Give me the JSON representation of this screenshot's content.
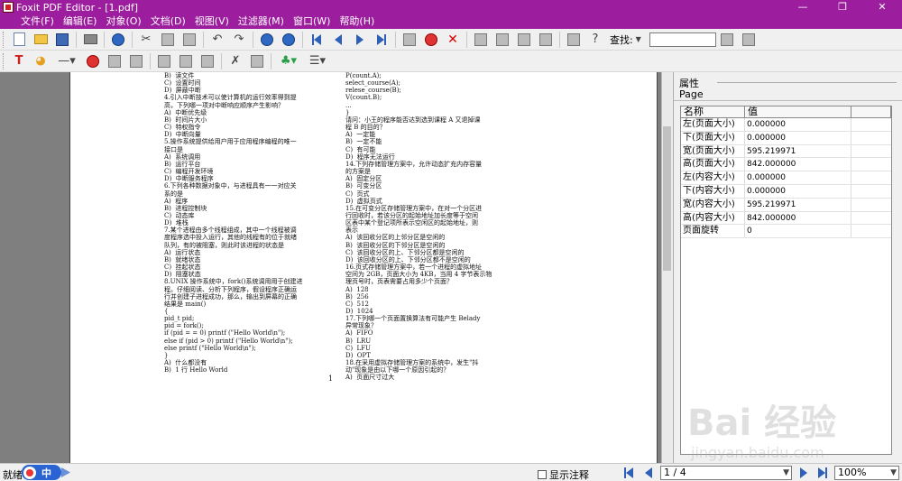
{
  "window": {
    "title": "Foxit PDF Editor - [1.pdf]",
    "controls": {
      "minimize": "—",
      "maximize": "❐",
      "close": "✕"
    }
  },
  "menu": [
    "文件(F)",
    "编辑(E)",
    "对象(O)",
    "文档(D)",
    "视图(V)",
    "过滤器(M)",
    "窗口(W)",
    "帮助(H)"
  ],
  "toolbar": {
    "search_label": "查找:",
    "search_value": ""
  },
  "document": {
    "page_number": "1",
    "column1": [
      "B)  读文件",
      "C)  设置时间",
      "D)  屏蔽中断",
      "4.引入中断技术可以使计算机的运行效率得到提",
      "高，下列哪一项对中断响应顺序产生影响？",
      "A)  中断优先级",
      "B)  时间片大小",
      "C)  特权指令",
      "D)  中断向量",
      "5.操作系统提供给用户用于应用程序编程的唯一",
      "接口是",
      "A)  系统调用",
      "B)  运行平台",
      "C)  编程开发环境",
      "D)  中断服务程序",
      "6.下列各种数据对象中，与进程具有一一对应关",
      "系的是",
      "A)  程序",
      "B)  进程控制块",
      "C)  动态库",
      "D)  堆栈",
      "7.某个进程由多个线程组成，其中一个线程被调",
      "度程序选中投入运行，其他的线程有的位于就绪",
      "队列，有的被阻塞，则此时该进程的状态是",
      "A)  运行状态",
      "B)  就绪状态",
      "C)  挂起状态",
      "D)  阻塞状态",
      "8.UNIX 操作系统中，fork()系统调用用于创建进",
      "程。仔细阅读、分析下列程序，假设程序正确运",
      "行并创建子进程成功，那么，输出到屏幕的正确",
      "结果是 main()",
      "{",
      "pid_t pid;",
      "pid = fork();",
      "if (pid = = 0) printf (\"Hello World\\n\");",
      "else if (pid > 0) printf (\"Hello World\\n\");",
      "else printf (\"Hello World\\n\");",
      "}",
      "A)  什么都没有",
      "B)  1 行 Hello World"
    ],
    "column2": [
      "P(count.A);",
      "select_course(A);",
      "relese_course(B);",
      "V(count.B);",
      "...",
      "}",
      "请问：小王的程序能否达到选到课程 A 又退掉课",
      "程 B 的目的？",
      "A)  一定能",
      "B)  一定不能",
      "C)  有可能",
      "D)  程序无法运行",
      "14.下列存储管理方案中，允许动态扩充内存容量",
      "的方案是",
      "A)  固定分区",
      "B)  可变分区",
      "C)  页式",
      "D)  虚拟页式",
      "15.在可变分区存储管理方案中，在对一个分区进",
      "行回收时，若该分区的起始地址加长度等于空闲",
      "区表中某个登记项所表示空闲区的起始地址，则",
      "表示",
      "A)  该回收分区的上邻分区是空闲的",
      "B)  该回收分区的下邻分区是空闲的",
      "C)  该回收分区的上、下邻分区都是空闲的",
      "D)  该回收分区的上、下邻分区都不是空闲的",
      "16.页式存储管理方案中，若一个进程的虚拟地址",
      "空间为 2GB，页面大小为 4KB，当用 4 字节表示物",
      "理页号时，页表需要占用多少个页面？",
      "A)  128",
      "B)  256",
      "C)  512",
      "D)  1024",
      "17.下列哪一个页面置换算法有可能产生 Belady",
      "异常现象？",
      "A)  FIFO",
      "B)  LRU",
      "C)  LFU",
      "D)  OPT",
      "18.在采用虚拟存储管理方案的系统中，发生\"抖",
      "动\"现象是由以下哪一个原因引起的？",
      "A)  页面尺寸过大"
    ]
  },
  "panel": {
    "title": "属性",
    "tab": "Page",
    "headers": [
      "名称",
      "值"
    ],
    "rows": [
      {
        "name": "左(页面大小)",
        "value": "0.000000"
      },
      {
        "name": "下(页面大小)",
        "value": "0.000000"
      },
      {
        "name": "宽(页面大小)",
        "value": "595.219971"
      },
      {
        "name": "高(页面大小)",
        "value": "842.000000"
      },
      {
        "name": "左(内容大小)",
        "value": "0.000000"
      },
      {
        "name": "下(内容大小)",
        "value": "0.000000"
      },
      {
        "name": "宽(内容大小)",
        "value": "595.219971"
      },
      {
        "name": "高(内容大小)",
        "value": "842.000000"
      },
      {
        "name": "页面旋转",
        "value": "0"
      }
    ]
  },
  "statusbar": {
    "status": "就绪",
    "ime_label": "中",
    "show_annotations": "显示注释",
    "page_indicator": "1 / 4",
    "zoom": "100%"
  },
  "watermark": {
    "main": "Bai 经验",
    "sub": "jingyan.baidu.com"
  },
  "colors": {
    "titlebar": "#9c1e9e",
    "nav_blue": "#2e60b8"
  }
}
